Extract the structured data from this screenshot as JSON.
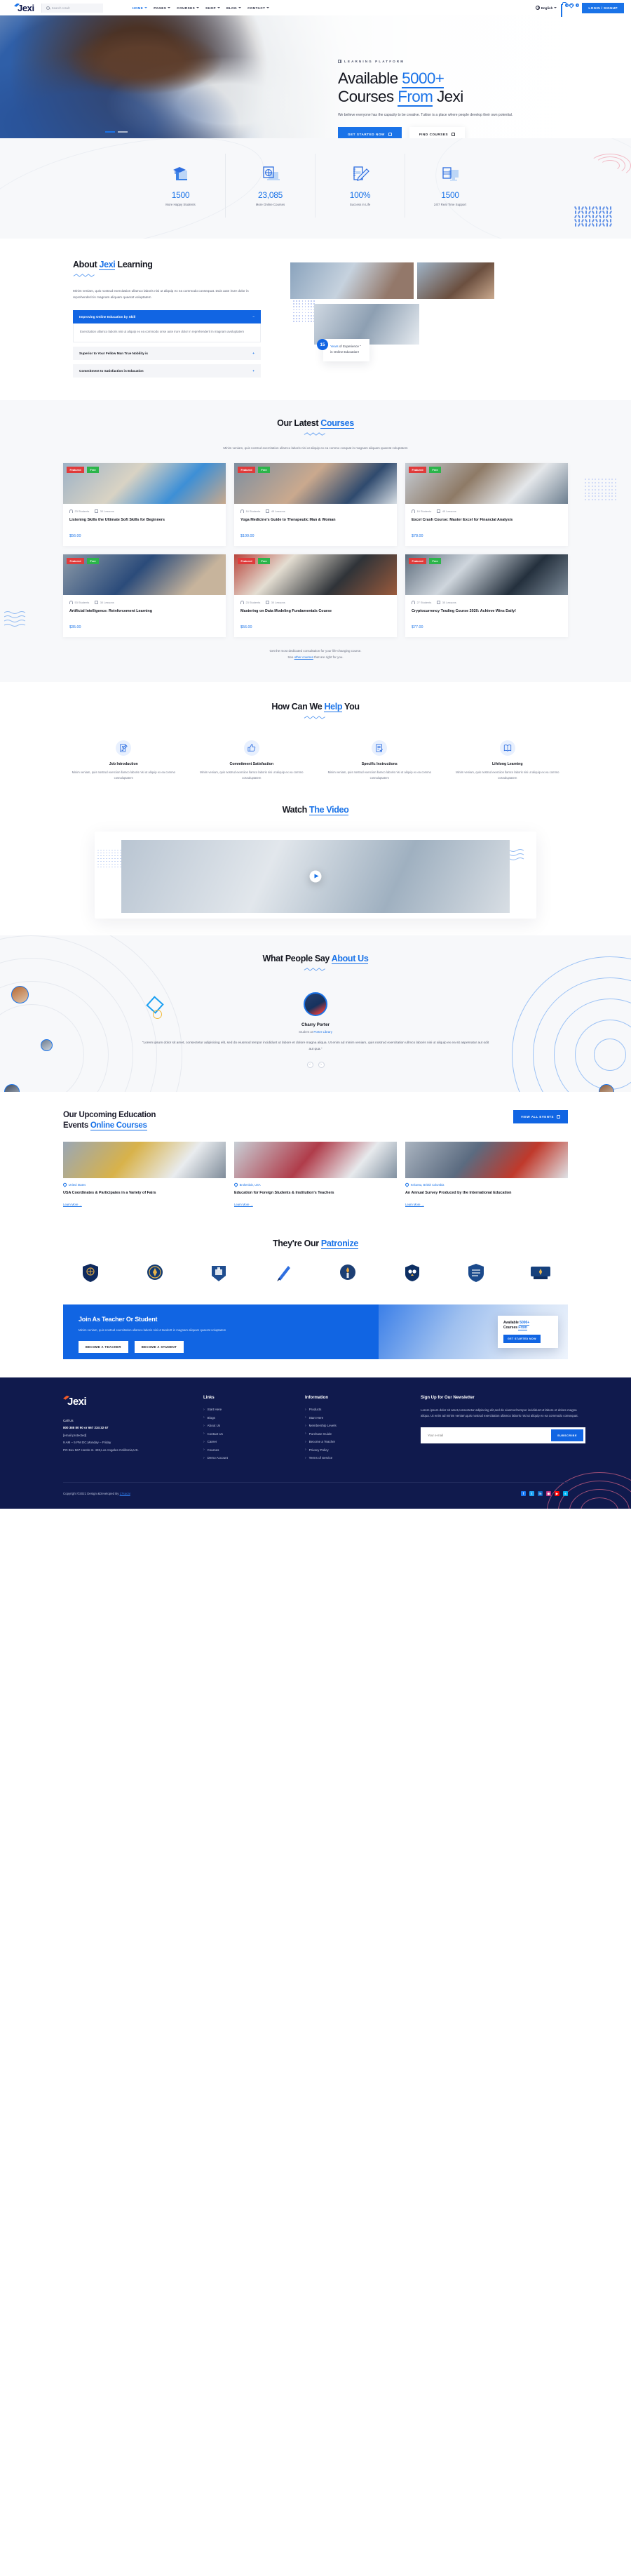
{
  "header": {
    "brand": "Jexi",
    "search_placeholder": "Search result",
    "nav": [
      {
        "label": "HOME",
        "active": true
      },
      {
        "label": "PAGES",
        "active": false
      },
      {
        "label": "COURSES",
        "active": false
      },
      {
        "label": "SHOP",
        "active": false
      },
      {
        "label": "BLOG",
        "active": false
      },
      {
        "label": "CONTACT",
        "active": false
      }
    ],
    "language": "English",
    "cart_count": "0",
    "wishlist_count": "0",
    "login_label": "LOGIN / SIGNUP"
  },
  "hero": {
    "eyebrow": "LEARNING PLATFORM",
    "title_1": "Available ",
    "title_hl_1": "5000+",
    "title_2": "Courses ",
    "title_hl_2": "From",
    "title_3": " Jexi",
    "subtitle": "We believe everyone has the capacity to be creative. Tuition is a place where people develop their own potential.",
    "btn_primary": "GET STARTED NOW",
    "btn_secondary": "FIND COURSES"
  },
  "stats": [
    {
      "icon": "graduation-book-icon",
      "value": "1500",
      "label": "More Happy Students"
    },
    {
      "icon": "globe-laptop-icon",
      "value": "23,085",
      "label": "More Online Courses"
    },
    {
      "icon": "notebook-pencil-icon",
      "value": "100%",
      "label": "Success in Life"
    },
    {
      "icon": "books-monitor-icon",
      "value": "1500",
      "label": "24/7 Real Time Support"
    }
  ],
  "about": {
    "title_1": "About ",
    "title_hl": "Jexi",
    "title_2": " Learning",
    "desc": "Minim veniam, quis nostrud exercitation ullamco laboris nisi ut aliquip ex ea commodo consequat. Duis aute irure dolor in reprehenderit in magnam aliquam quaerat voluptatem",
    "accordion": [
      {
        "title": "Improving Online Education by Skill",
        "open": true,
        "sign": "–",
        "body": "Exercitation ullamco laboris nisi ut aliquip ex ea commodo onse aute irure dolor in reprehenderit in magnam avoluptatem"
      },
      {
        "title": "Superior to Your Fellow Man True Nobility is",
        "open": false,
        "sign": "+",
        "body": ""
      },
      {
        "title": "Commitment to Satisfaction in Education",
        "open": false,
        "sign": "+",
        "body": ""
      }
    ],
    "badge_number": "15",
    "badge_line1_hl": "Years",
    "badge_line1": " of Experience \"",
    "badge_line2": "in Online Education!"
  },
  "courses": {
    "title_1": "Our Latest ",
    "title_hl": "Courses",
    "desc": "Minim veniam, quis nostrud exercitation ullamco laboris nisi ut aliquip ex ea commo cosquat in magnam aliquam quaerat voluptatem",
    "tag_featured": "Featured",
    "tag_free": "Free",
    "items": [
      {
        "students": "23 Students",
        "lessons": "30 Lessons",
        "title": "Listening Skills the Ultimate Soft Skills for Beginners",
        "price": "$56.00"
      },
      {
        "students": "16 Students",
        "lessons": "45 Lessons",
        "title": "Yoga Medicine's Guide to Therapeutic Man & Woman",
        "price": "$100.00"
      },
      {
        "students": "16 Students",
        "lessons": "45 Lessons",
        "title": "Excel Crash Course: Master Excel for Financial Analysis",
        "price": "$78.00"
      },
      {
        "students": "53 Students",
        "lessons": "30 Lessons",
        "title": "Artificial Intelligence: Reinforcement Learning",
        "price": "$35.00"
      },
      {
        "students": "23 Students",
        "lessons": "30 Lessons",
        "title": "Mastering on Data Modeling Fundamentals Course",
        "price": "$56.00"
      },
      {
        "students": "27 Students",
        "lessons": "35 Lessons",
        "title": "Cryptocurrency Trading Course 2020: Achieve Wins Daily!",
        "price": "$77.00"
      }
    ],
    "note_line1": "Get the most dedicated consultation for your life-changing course.",
    "note_see": "See ",
    "note_link": "other courses",
    "note_tail": " that are right for you."
  },
  "help": {
    "title_1": "How Can We ",
    "title_hl": "Help",
    "title_2": " You",
    "items": [
      {
        "icon": "document-pen-icon",
        "title": "Job Introduction",
        "desc": "Minim veniam, quis nostrud exerciion llamco laboris nisi ut aliquip ex ea commo cosnaluptatem"
      },
      {
        "icon": "thumbs-up-icon",
        "title": "Commitment Satisfaction",
        "desc": "Minim veniam, quis nostrud exerciion llamco laboris nisi ut aliquip ex ea commo cosnaluptatem"
      },
      {
        "icon": "checklist-icon",
        "title": "Specific Instructions",
        "desc": "Minim veniam, quis nostrud exerciion llamco laboris nisi ut aliquip ex ea commo cosnaluptatem"
      },
      {
        "icon": "open-book-icon",
        "title": "Lifelong Learning",
        "desc": "Minim veniam, quis nostrud exerciion llamco laboris nisi ut aliquip ex ea commo cosnaluptatem"
      }
    ]
  },
  "video": {
    "title_1": "Watch ",
    "title_hl": "The Video",
    "play_label": "play-button"
  },
  "testimonial": {
    "title_1": "What People Say ",
    "title_hl": "About Us",
    "name": "Charry Porter",
    "role_pre": "Student at ",
    "role_hl": "Porter Library",
    "quote": "\"Lorem ipsum dolor sit amet, consectetur adipisicing elit, sed do eiusmod tempor incididunt ut labore et dolore magna aliqua. Ut enim ad minim veniam, quis nostrud exercitation ullmco laboris nisi ut aliquip ex ea sit aspernatur aut odit aut qua.\"",
    "prev": "‹",
    "next": "›"
  },
  "events": {
    "title_1": "Our Upcoming Education",
    "title_2": "Events ",
    "title_hl": "Online Courses",
    "view_all": "VIEW ALL EVENTS",
    "items": [
      {
        "location": "United States",
        "title": "USA Coordinates & Participates in a Variety of Fairs",
        "learn_more": "Learn More →"
      },
      {
        "location": "Brokenlain, USA",
        "title": "Education for Foreign Students & Institution's Teachers",
        "learn_more": "Learn More →"
      },
      {
        "location": "Kelowna, British Columbia",
        "title": "An Annual Survey Produced by the International Education",
        "learn_more": "Learn More →"
      }
    ]
  },
  "partners": {
    "title_1": "They're Our ",
    "title_hl": "Patronize",
    "logos": [
      "university-shield-1",
      "university-crest-2",
      "university-badge-3",
      "pen-emblem-4",
      "torch-seal-5",
      "owl-crest-6",
      "shield-seal-7",
      "ribbon-badge-8"
    ]
  },
  "cta": {
    "title": "Join As Teacher Or Student",
    "desc": "Minim veniam, quis nostrud exercitation ullamco laboris nisi ut tandertt in magnam aliquam quaerat voluptatem",
    "btn1": "BECOME A TEACHER",
    "btn2": "BECOME A STUDENT",
    "card_pre": "Available ",
    "card_hl": "5000+",
    "card_post": "Courses ",
    "card_hl2": "From",
    "card_btn": "GET STARTED NOW"
  },
  "footer": {
    "brand": "Jexi",
    "call_label": "Call Us",
    "phone": "800 388 80 90 or 667 234 32 67",
    "email": "[email protected]",
    "hours": "9 AM – 5 PM DC,Monday – Friday",
    "address": "PO Box 567 Hostin st. 433,Los Angeles California,US.",
    "links_title": "Links",
    "links": [
      "Start Here",
      "Blogs",
      "About Us",
      "Contact Us",
      "Career",
      "Courses",
      "Demo Account"
    ],
    "info_title": "Information",
    "info": [
      "Products",
      "Start Here",
      "Membership Levels",
      "Purchase Guide",
      "Become a Teacher",
      "Privacy Policy",
      "Terms of Service"
    ],
    "news_title": "Sign Up for Our Newsletter",
    "news_desc": "Lorem ipsum dolor sit amet,consectetur adipiscing elit,sed do eiusmod tempor incididunt ut labore et dolore magna aliqua. Ut enim ad minim veniam,quis nostrud exercitation ullamco laboris nisi ut aliquip ex ea commodo consequat.",
    "news_placeholder": "Your e-mail",
    "subscribe": "SUBSCRIBE",
    "copyright_pre": "Copyright ©2021 Design &Developed By ",
    "copyright_link": "17sucai",
    "socials": [
      "facebook-icon",
      "twitter-icon",
      "linkedin-icon",
      "instagram-icon",
      "youtube-icon",
      "skype-icon"
    ]
  },
  "colors": {
    "accent": "#1a73e8",
    "accent_dark": "#1165e3",
    "navy": "#101a4d",
    "red": "#e03b3b",
    "green": "#2bb54a",
    "orange": "#f05a28"
  }
}
